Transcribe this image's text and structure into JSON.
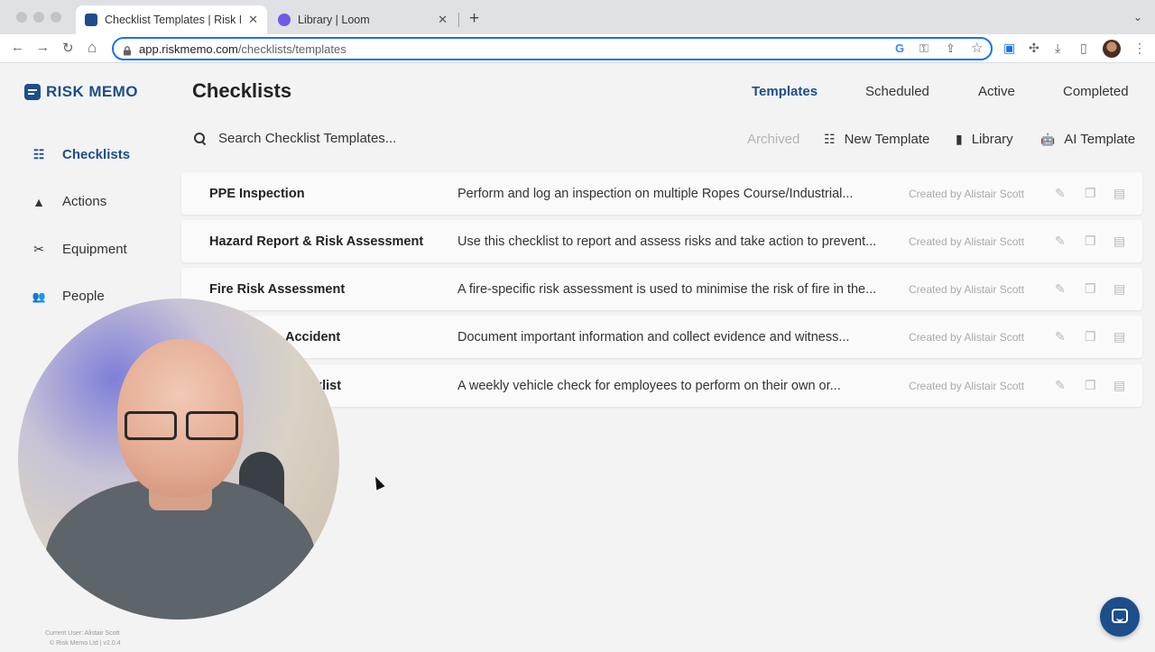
{
  "browser": {
    "tabs": [
      {
        "title": "Checklist Templates | Risk Memo",
        "active": true
      },
      {
        "title": "Library | Loom",
        "active": false
      }
    ],
    "url_host": "app.riskmemo.com",
    "url_path": "/checklists/templates",
    "icons": {
      "back": "←",
      "forward": "→",
      "reload": "↻",
      "home": "⌂",
      "google": "G",
      "key": "⚿",
      "share": "⇪",
      "star": "☆",
      "ext1": "▣",
      "puzzle": "✣",
      "download": "⤓",
      "sidebar": "▯",
      "menu": "⋮",
      "close": "✕",
      "new_tab": "+",
      "tab_chevron": "⌄"
    }
  },
  "app": {
    "logo": "RISK MEMO",
    "title": "Checklists",
    "tabs": [
      "Templates",
      "Scheduled",
      "Active",
      "Completed"
    ],
    "sidebar": [
      {
        "label": "Checklists",
        "icon": "☷",
        "active": true
      },
      {
        "label": "Actions",
        "icon": "▲",
        "active": false
      },
      {
        "label": "Equipment",
        "icon": "✂",
        "active": false
      },
      {
        "label": "People",
        "icon": "👥",
        "active": false
      }
    ],
    "search_placeholder": "Search Checklist Templates...",
    "actions": {
      "archived": "Archived",
      "new_template": "New Template",
      "library": "Library",
      "ai_template": "AI Template",
      "new_template_icon": "☷",
      "library_icon": "▮",
      "ai_template_icon": "🤖"
    },
    "templates": [
      {
        "name": "PPE Inspection",
        "desc": "Perform and log an inspection on multiple Ropes Course/Industrial...",
        "by": "Created by Alistair Scott"
      },
      {
        "name": "Hazard Report & Risk Assessment",
        "desc": "Use this checklist to report and assess risks and take action to prevent...",
        "by": "Created by Alistair Scott"
      },
      {
        "name": "Fire Risk Assessment",
        "desc": "A fire-specific risk assessment is used to minimise the risk of fire in the...",
        "by": "Created by Alistair Scott"
      },
      {
        "name": "Accident",
        "desc": "Document important information and collect evidence and witness...",
        "by": "Created by Alistair Scott"
      },
      {
        "name": "cklist",
        "desc": "A weekly vehicle check for employees to perform on their own or...",
        "by": "Created by Alistair Scott"
      }
    ],
    "row_icons": {
      "edit": "✎",
      "copy": "❐",
      "archive": "▤"
    },
    "footer": {
      "user": "Current User: Alistair Scott",
      "copyright": "© Risk Memo Ltd | v2.0.4"
    }
  },
  "colors": {
    "brand": "#1d4e89",
    "muted": "#b3b3b3"
  }
}
